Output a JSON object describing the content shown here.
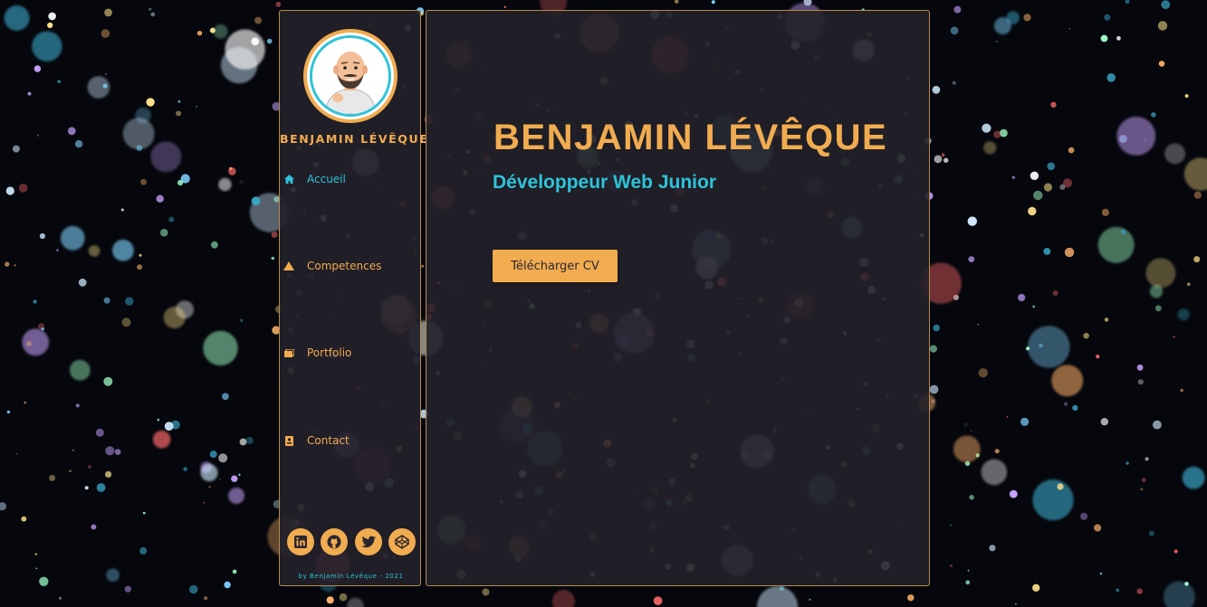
{
  "profile": {
    "name": "BENJAMIN LÉVÊQUE",
    "title": "Développeur Web Junior"
  },
  "nav": {
    "items": [
      {
        "label": "Accueil",
        "icon": "home-icon",
        "active": true
      },
      {
        "label": "Competences",
        "icon": "warning-triangle-icon",
        "active": false
      },
      {
        "label": "Portfolio",
        "icon": "images-icon",
        "active": false
      },
      {
        "label": "Contact",
        "icon": "address-card-icon",
        "active": false
      }
    ]
  },
  "hero": {
    "name": "BENJAMIN LÉVÊQUE",
    "subtitle": "Développeur Web Junior",
    "download_button": "Télécharger CV"
  },
  "social": [
    {
      "icon": "linkedin-icon"
    },
    {
      "icon": "github-icon"
    },
    {
      "icon": "twitter-icon"
    },
    {
      "icon": "codepen-icon"
    }
  ],
  "footer": {
    "credit": "by Benjamin Lévêque - 2021"
  },
  "colors": {
    "accent_orange": "#f1ac50",
    "accent_cyan": "#2ec3d8",
    "panel": "#23212a",
    "border": "#b98a4a"
  }
}
